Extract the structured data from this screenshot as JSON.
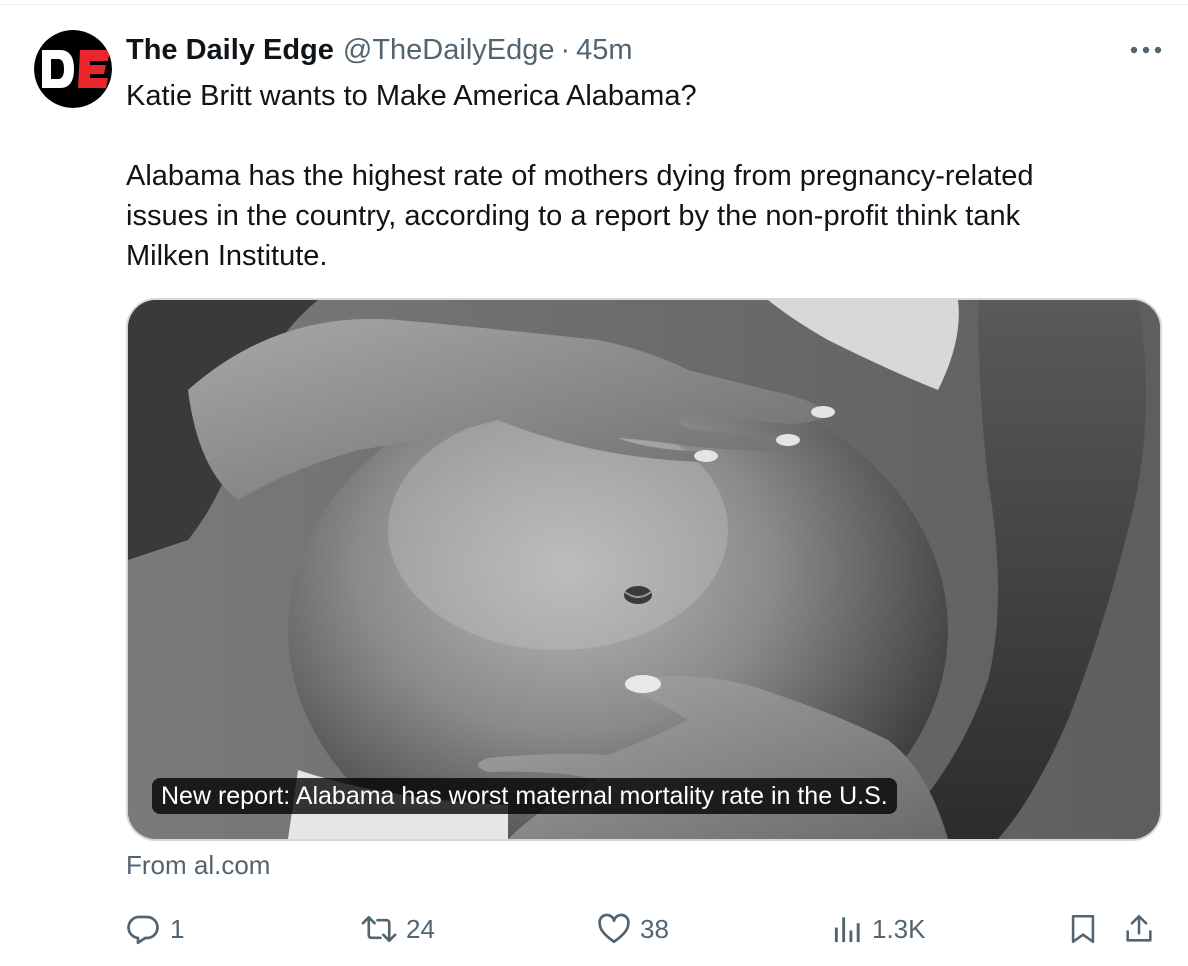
{
  "post": {
    "author_name": "The Daily Edge",
    "author_handle": "@TheDailyEdge",
    "separator": "·",
    "time_ago": "45m",
    "text_line_1": "Katie Britt wants to Make America Alabama?",
    "text_line_2": "Alabama has the highest rate of mothers dying from pregnancy-related",
    "text_line_3": "issues in the country, according to a report by the non-profit think tank",
    "text_line_4": "Milken Institute."
  },
  "link_card": {
    "caption": "New report: Alabama has worst maternal mortality rate in the U.S.",
    "source": "From al.com"
  },
  "actions": {
    "replies": "1",
    "reposts": "24",
    "likes": "38",
    "views": "1.3K"
  },
  "icons": {
    "avatar": "daily-edge-logo",
    "more": "more-horizontal-icon",
    "reply": "reply-icon",
    "repost": "repost-icon",
    "like": "heart-icon",
    "views": "views-bar-chart-icon",
    "bookmark": "bookmark-icon",
    "share": "share-icon"
  },
  "colors": {
    "text_primary": "#0f1419",
    "text_secondary": "#536471",
    "border": "#cfd9de",
    "logo_red": "#e8262c"
  }
}
